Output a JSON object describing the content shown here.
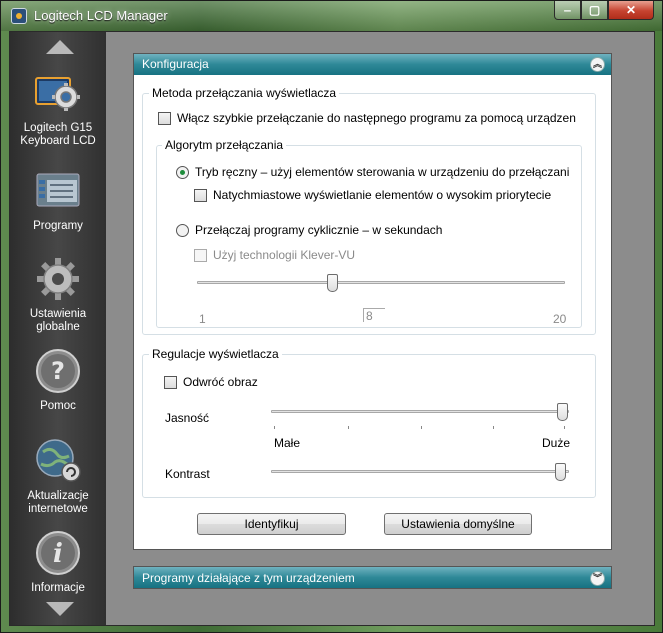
{
  "window": {
    "title": "Logitech LCD Manager"
  },
  "window_controls": {
    "minimize": "‒",
    "maximize": "▢",
    "close": "✕"
  },
  "sidebar": {
    "items": [
      {
        "label_line1": "Logitech G15",
        "label_line2": "Keyboard LCD",
        "icon": "gear-monitor-icon"
      },
      {
        "label_line1": "Programy",
        "label_line2": "",
        "icon": "programs-list-icon"
      },
      {
        "label_line1": "Ustawienia",
        "label_line2": "globalne",
        "icon": "gear-icon"
      },
      {
        "label_line1": "Pomoc",
        "label_line2": "",
        "icon": "help-icon"
      },
      {
        "label_line1": "Aktualizacje",
        "label_line2": "internetowe",
        "icon": "globe-update-icon"
      },
      {
        "label_line1": "Informacje",
        "label_line2": "",
        "icon": "info-icon"
      }
    ]
  },
  "config_panel": {
    "title": "Konfiguracja",
    "collapse_glyph": "︽",
    "switch_method": {
      "legend": "Metoda przełączania wyświetlacza",
      "fast_switch_label": "Włącz szybkie przełączanie do następnego programu za pomocą urządzen",
      "algorithm": {
        "legend": "Algorytm przełączania",
        "manual_label": "Tryb ręczny – użyj elementów sterowania w urządzeniu do przełączani",
        "instant_priority_label": "Natychmiastowe wyświetlanie elementów o wysokim priorytecie",
        "cyclic_label": "Przełączaj programy cyklicznie – w sekundach",
        "klever_label": "Użyj technologii Klever-VU",
        "slider_min": "1",
        "slider_max": "20",
        "slider_value": "8"
      }
    },
    "display_adjust": {
      "legend": "Regulacje wyświetlacza",
      "invert_label": "Odwróć obraz",
      "brightness_label": "Jasność",
      "brightness_low": "Małe",
      "brightness_high": "Duże",
      "contrast_label": "Kontrast"
    },
    "identify_button": "Identyfikuj",
    "defaults_button": "Ustawienia domyślne"
  },
  "running_panel": {
    "title": "Programy działające z tym urządzeniem",
    "expand_glyph": "︾"
  }
}
